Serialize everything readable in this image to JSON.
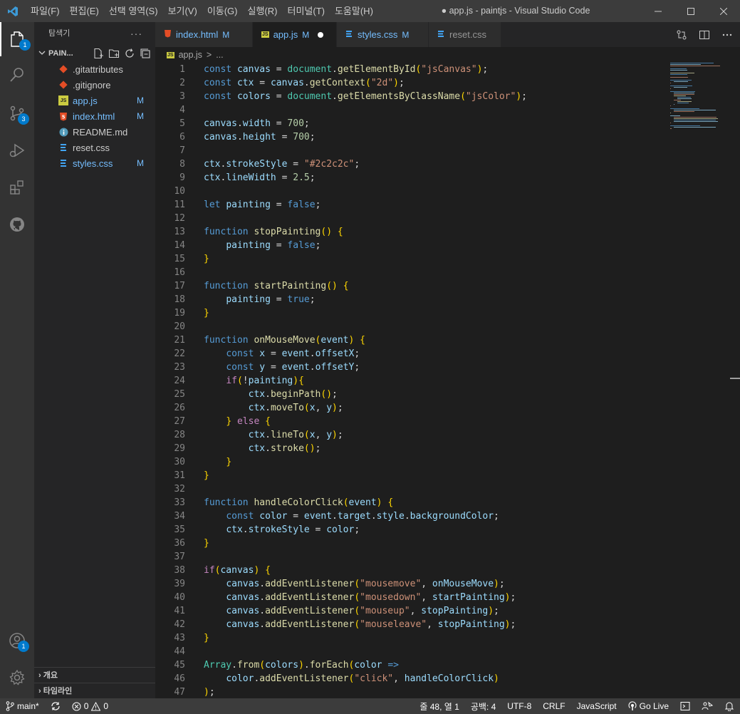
{
  "titlebar": {
    "menu": [
      "파일(F)",
      "편집(E)",
      "선택 영역(S)",
      "보기(V)",
      "이동(G)",
      "실행(R)",
      "터미널(T)",
      "도움말(H)"
    ],
    "window_title": "● app.js - paintjs - Visual Studio Code"
  },
  "activitybar": {
    "items": [
      "explorer-icon",
      "search-icon",
      "source-control-icon",
      "run-debug-icon",
      "extensions-icon",
      "github-icon"
    ],
    "explorer_badge": "1",
    "scm_badge": "3",
    "accounts_badge": "1"
  },
  "sidebar": {
    "title": "탐색기",
    "more": "···",
    "folder": "PAIN...",
    "files": [
      {
        "name": ".gitattributes",
        "icon": "git-icon",
        "badge": "",
        "color": "#cccccc"
      },
      {
        "name": ".gitignore",
        "icon": "git-icon",
        "badge": "",
        "color": "#cccccc"
      },
      {
        "name": "app.js",
        "icon": "js-icon",
        "badge": "M",
        "color": "#75beff"
      },
      {
        "name": "index.html",
        "icon": "html-icon",
        "badge": "M",
        "color": "#75beff"
      },
      {
        "name": "README.md",
        "icon": "info-icon",
        "badge": "",
        "color": "#cccccc"
      },
      {
        "name": "reset.css",
        "icon": "css-icon",
        "badge": "",
        "color": "#cccccc"
      },
      {
        "name": "styles.css",
        "icon": "css-icon",
        "badge": "M",
        "color": "#75beff"
      }
    ],
    "outline": "개요",
    "timeline": "타임라인"
  },
  "tabs": [
    {
      "label": "index.html",
      "status": "M",
      "icon": "html-icon"
    },
    {
      "label": "app.js",
      "status": "M",
      "icon": "js-icon",
      "dirty": true
    },
    {
      "label": "styles.css",
      "status": "M",
      "icon": "css-icon"
    },
    {
      "label": "reset.css",
      "status": "",
      "icon": "css-icon"
    }
  ],
  "breadcrumb": {
    "file": "app.js",
    "sep": ">",
    "rest": "..."
  },
  "code_lines": [
    "const canvas = document.getElementById(\"jsCanvas\");",
    "const ctx = canvas.getContext(\"2d\");",
    "const colors = document.getElementsByClassName(\"jsColor\");",
    "",
    "canvas.width = 700;",
    "canvas.height = 700;",
    "",
    "ctx.strokeStyle = \"#2c2c2c\";",
    "ctx.lineWidth = 2.5;",
    "",
    "let painting = false;",
    "",
    "function stopPainting() {",
    "    painting = false;",
    "}",
    "",
    "function startPainting() {",
    "    painting = true;",
    "}",
    "",
    "function onMouseMove(event) {",
    "    const x = event.offsetX;",
    "    const y = event.offsetY;",
    "    if(!painting){",
    "        ctx.beginPath();",
    "        ctx.moveTo(x, y);",
    "    } else {",
    "        ctx.lineTo(x, y);",
    "        ctx.stroke();",
    "    }",
    "}",
    "",
    "function handleColorClick(event) {",
    "    const color = event.target.style.backgroundColor;",
    "    ctx.strokeStyle = color;",
    "}",
    "",
    "if(canvas) {",
    "    canvas.addEventListener(\"mousemove\", onMouseMove);",
    "    canvas.addEventListener(\"mousedown\", startPainting);",
    "    canvas.addEventListener(\"mouseup\", stopPainting);",
    "    canvas.addEventListener(\"mouseleave\", stopPainting);",
    "}",
    "",
    "Array.from(colors).forEach(color =>",
    "    color.addEventListener(\"click\", handleColorClick)",
    ");"
  ],
  "statusbar": {
    "branch": "main*",
    "errors": "0",
    "warnings": "0",
    "position": "줄 48, 열 1",
    "spaces": "공백: 4",
    "encoding": "UTF-8",
    "eol": "CRLF",
    "language": "JavaScript",
    "golive": "Go Live"
  },
  "colors": {
    "accent": "#007acc",
    "keyword": "#569cd6",
    "variable": "#9cdcfe",
    "function": "#dcdcaa",
    "string": "#ce9178",
    "number": "#b5cea8"
  }
}
